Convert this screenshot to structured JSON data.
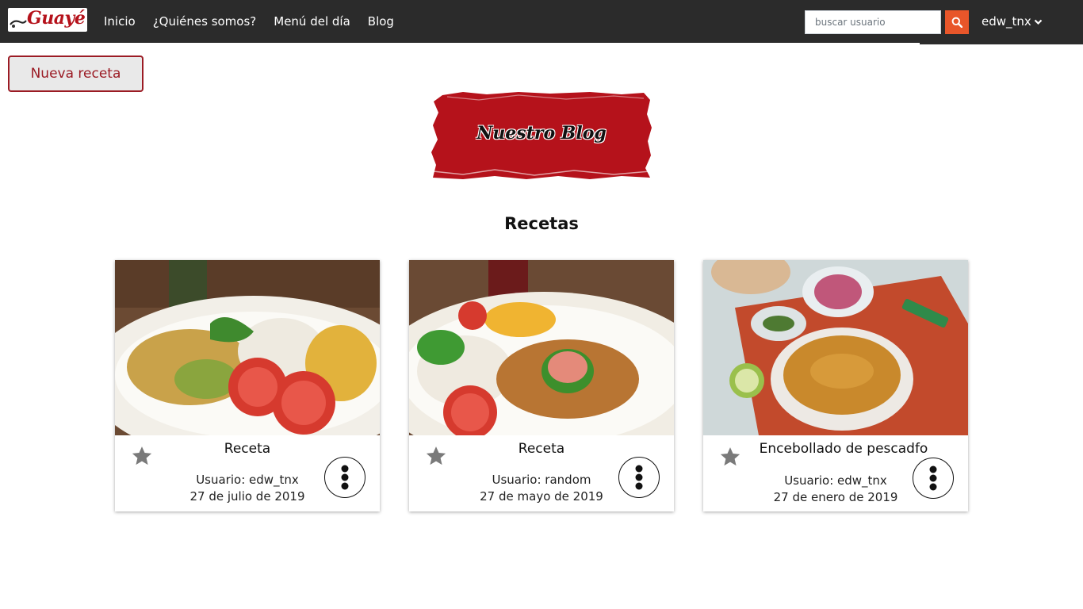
{
  "brand": {
    "logo_text": "Guayé"
  },
  "nav": {
    "links": [
      "Inicio",
      "¿Quiénes somos?",
      "Menú del día",
      "Blog"
    ],
    "search_placeholder": "buscar usuario",
    "user": "edw_tnx"
  },
  "actions": {
    "new_recipe": "Nueva receta"
  },
  "banner": {
    "title": "Nuestro Blog"
  },
  "section": {
    "title": "Recetas"
  },
  "recipes": [
    {
      "title": "Receta",
      "user": "Usuario: edw_tnx",
      "date": "27 de julio de 2019"
    },
    {
      "title": "Receta",
      "user": "Usuario: random",
      "date": "27 de mayo de 2019"
    },
    {
      "title": "Encebollado de pescadfo",
      "user": "Usuario: edw_tnx",
      "date": "27 de enero de 2019"
    }
  ],
  "icons": {
    "search": "search-icon",
    "dropdown": "chevron-down-icon",
    "favorite": "star-icon",
    "more": "more-vertical-icon"
  },
  "colors": {
    "navbar": "#2b2b2b",
    "accent_red": "#b5121b",
    "search_button": "#e8562a",
    "star": "#7a7a7a"
  }
}
